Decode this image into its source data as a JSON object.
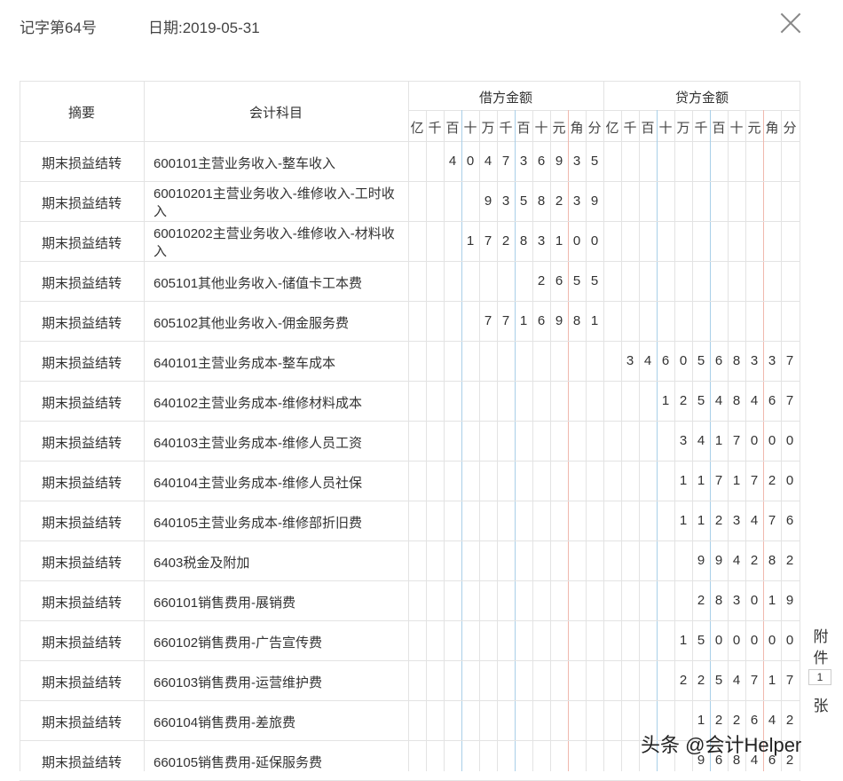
{
  "header": {
    "voucher_no": "记字第64号",
    "date": "日期:2019-05-31"
  },
  "columns": {
    "summary": "摘要",
    "account": "会计科目",
    "debit": "借方金额",
    "credit": "贷方金额",
    "units": [
      "亿",
      "千",
      "百",
      "十",
      "万",
      "千",
      "百",
      "十",
      "元",
      "角",
      "分"
    ]
  },
  "rows": [
    {
      "summary": "期末损益结转",
      "account": [
        "600101主营业务收入-整车收入"
      ],
      "debit": "404736935",
      "credit": ""
    },
    {
      "summary": "期末损益结转",
      "account": [
        "60010201主营业务收入-维修收入-工时收",
        "入"
      ],
      "debit": "9358239",
      "credit": ""
    },
    {
      "summary": "期末损益结转",
      "account": [
        "60010202主营业务收入-维修收入-材料收",
        "入"
      ],
      "debit": "17283100",
      "credit": ""
    },
    {
      "summary": "期末损益结转",
      "account": [
        "605101其他业务收入-储值卡工本费"
      ],
      "debit": "2655",
      "credit": ""
    },
    {
      "summary": "期末损益结转",
      "account": [
        "605102其他业务收入-佣金服务费"
      ],
      "debit": "7716981",
      "credit": ""
    },
    {
      "summary": "期末损益结转",
      "account": [
        "640101主营业务成本-整车成本"
      ],
      "debit": "",
      "credit": "3460568337"
    },
    {
      "summary": "期末损益结转",
      "account": [
        "640102主营业务成本-维修材料成本"
      ],
      "debit": "",
      "credit": "125484 67"
    },
    {
      "summary": "期末损益结转",
      "account": [
        "640103主营业务成本-维修人员工资"
      ],
      "debit": "",
      "credit": "3417000"
    },
    {
      "summary": "期末损益结转",
      "account": [
        "640104主营业务成本-维修人员社保"
      ],
      "debit": "",
      "credit": "1171720"
    },
    {
      "summary": "期末损益结转",
      "account": [
        "640105主营业务成本-维修部折旧费"
      ],
      "debit": "",
      "credit": "1123476"
    },
    {
      "summary": "期末损益结转",
      "account": [
        "6403税金及附加"
      ],
      "debit": "",
      "credit": "994282"
    },
    {
      "summary": "期末损益结转",
      "account": [
        "660101销售费用-展销费"
      ],
      "debit": "",
      "credit": "283019"
    },
    {
      "summary": "期末损益结转",
      "account": [
        "660102销售费用-广告宣传费"
      ],
      "debit": "",
      "credit": "1500000"
    },
    {
      "summary": "期末损益结转",
      "account": [
        "660103销售费用-运营维护费"
      ],
      "debit": "",
      "credit": "2254717"
    },
    {
      "summary": "期末损益结转",
      "account": [
        "660104销售费用-差旅费"
      ],
      "debit": "",
      "credit": "122642"
    },
    {
      "summary": "期末损益结转",
      "account": [
        "660105销售费用-延保服务费"
      ],
      "debit": "",
      "credit": "968462"
    }
  ],
  "attachment": {
    "label_top": "附",
    "label_mid": "件",
    "count": "1",
    "label_bottom": "张"
  },
  "watermark": "头条 @会计Helper",
  "colors": {
    "grid": "#e3e3e3",
    "blue_separator": "#a9cfe8",
    "red_separator": "#f0b8ae"
  }
}
